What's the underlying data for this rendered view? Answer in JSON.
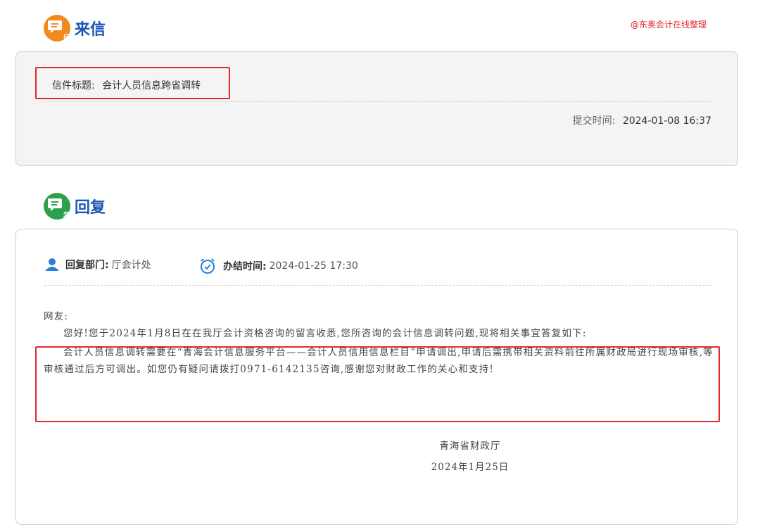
{
  "letter_section": {
    "title": "来信",
    "badge_sub": "问",
    "watermark": "@东奥会计在线整理",
    "subject_label": "信件标题:",
    "subject": "会计人员信息跨省调转",
    "submit_label": "提交时间:",
    "submit_time": "2024-01-08 16:37"
  },
  "reply_section": {
    "title": "回复",
    "badge_sub": "答",
    "dept_label": "回复部门:",
    "dept": "厅会计处",
    "done_label": "办结时间:",
    "done_time": "2024-01-25 17:30",
    "greeting": "网友:",
    "paragraphs": [
      "您好!您于2024年1月8日在在我厅会计资格咨询的留言收悉,您所咨询的会计信息调转问题,现将相关事宜答复如下:",
      "会计人员信息调转需要在“青海会计信息服务平台——会计人员信用信息栏目”申请调出,申请后需携带相关资料前往所属财政局进行现场审核,等审核通过后方可调出。如您仍有疑问请拨打0971-6142135咨询,感谢您对财政工作的关心和支持!"
    ],
    "signature": "青海省财政厅",
    "date": "2024年1月25日"
  },
  "colors": {
    "letter_badge": "#f08a1c",
    "reply_badge": "#2aa14a",
    "heading_blue": "#1a56b4",
    "highlight_red": "#e32929",
    "icon_blue": "#2b7fd6"
  }
}
